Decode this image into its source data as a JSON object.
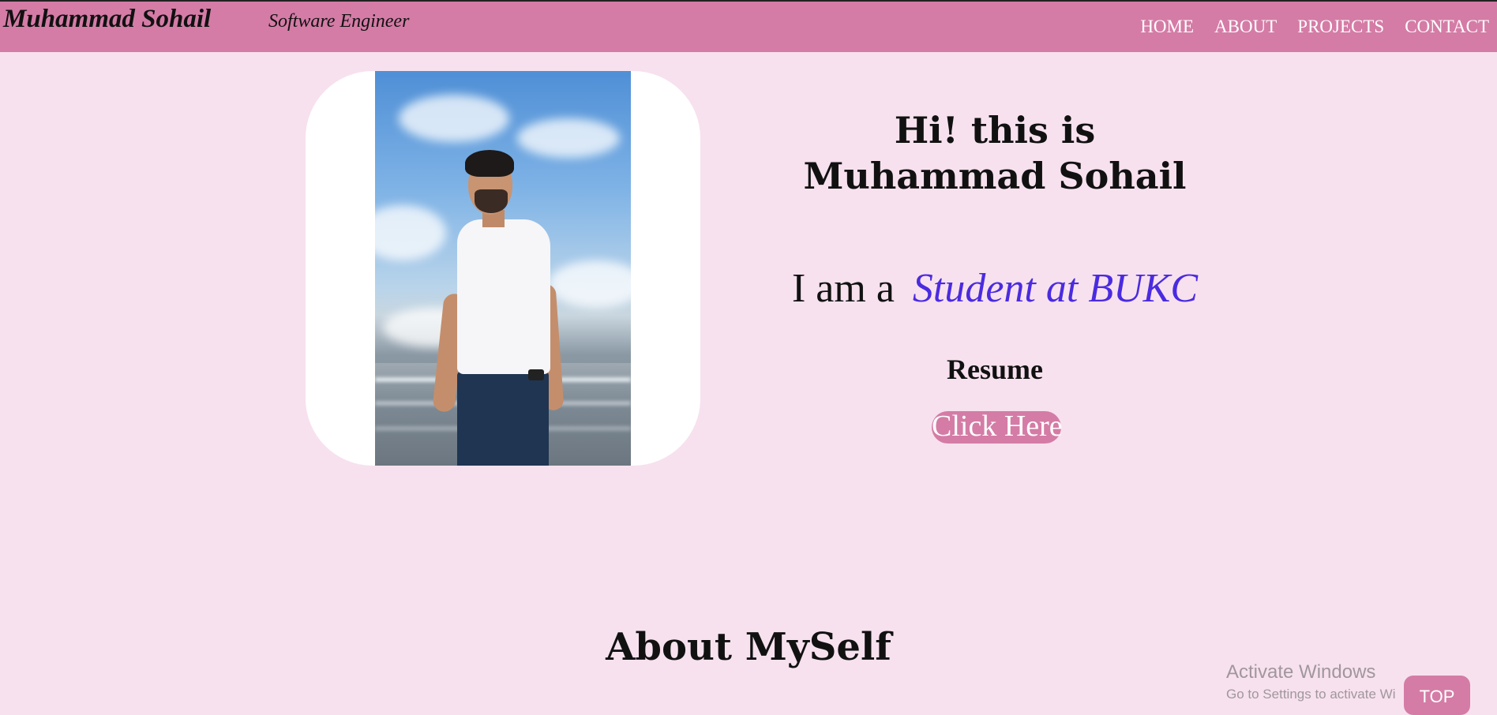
{
  "header": {
    "brand": "Muhammad Sohail",
    "tagline": "Software Engineer",
    "nav": [
      {
        "label": "HOME"
      },
      {
        "label": "ABOUT"
      },
      {
        "label": "PROJECTS"
      },
      {
        "label": "CONTACT"
      }
    ]
  },
  "hero": {
    "greeting_line1": "Hi! this is",
    "greeting_line2": "Muhammad Sohail",
    "role_prefix": "I am a",
    "role_highlight": "Student at BUKC",
    "resume_label": "Resume",
    "resume_button": "Click Here"
  },
  "about": {
    "title": "About MySelf"
  },
  "overlay": {
    "activate_title": "Activate Windows",
    "activate_sub": "Go to Settings to activate Wi",
    "top_button": "TOP"
  },
  "colors": {
    "nav_bg": "#d47ca6",
    "page_bg": "#f7e1ee",
    "highlight": "#4a2be0"
  }
}
